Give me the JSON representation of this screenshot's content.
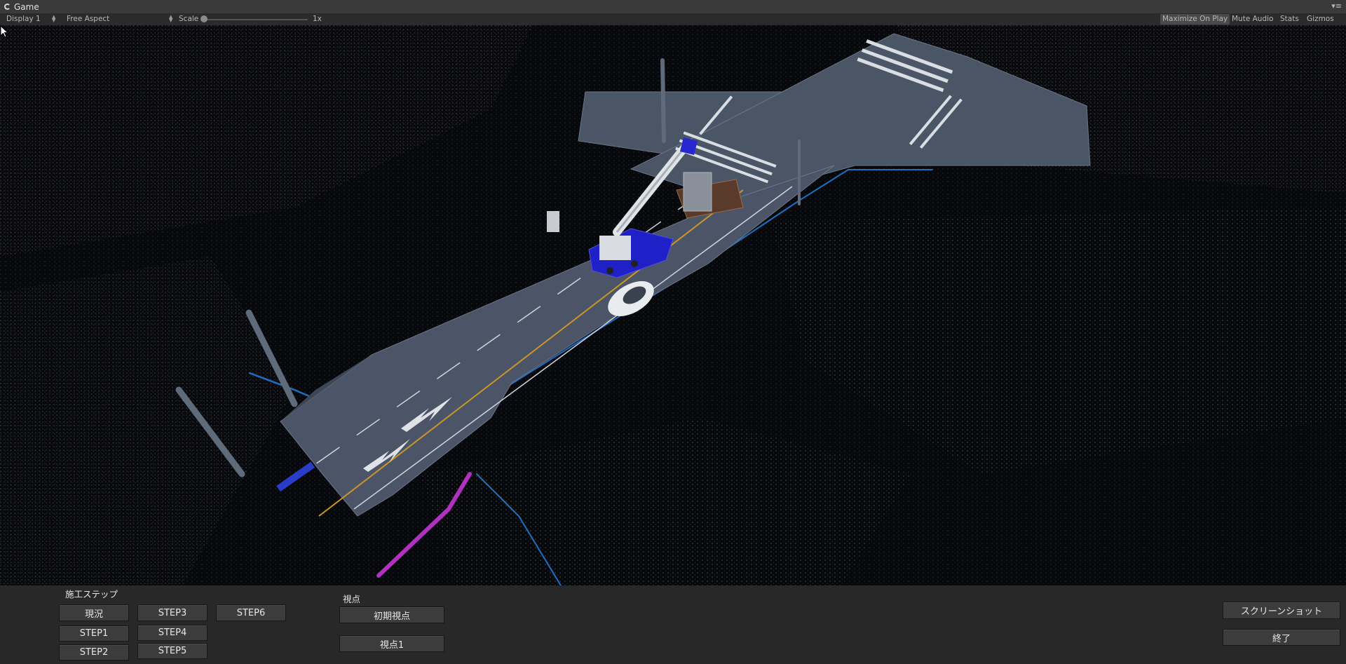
{
  "window": {
    "tab_title": "Game",
    "tab_icon": "unity-icon",
    "menu_icon": "window-menu-icon"
  },
  "toolbar": {
    "display": "Display 1",
    "aspect": "Free Aspect",
    "scale_label": "Scale",
    "scale_value": "1x",
    "scale_level": 0,
    "maximize_on_play": "Maximize On Play",
    "maximize_on_play_active": true,
    "mute_audio": "Mute Audio",
    "stats": "Stats",
    "gizmos": "Gizmos"
  },
  "panel": {
    "step_heading": "施工ステップ",
    "steps": [
      "現況",
      "STEP1",
      "STEP2",
      "STEP3",
      "STEP4",
      "STEP5",
      "STEP6"
    ],
    "view_heading": "視点",
    "views": [
      "初期視点",
      "視点1"
    ],
    "screenshot": "スクリーンショット",
    "quit": "終了"
  },
  "colors": {
    "background": "#07080c",
    "road": "#4a5566",
    "crane": "#2020c8",
    "conduit_blue": "#1e6fc0",
    "conduit_magenta": "#b030c0",
    "centerline": "#c9962a"
  }
}
